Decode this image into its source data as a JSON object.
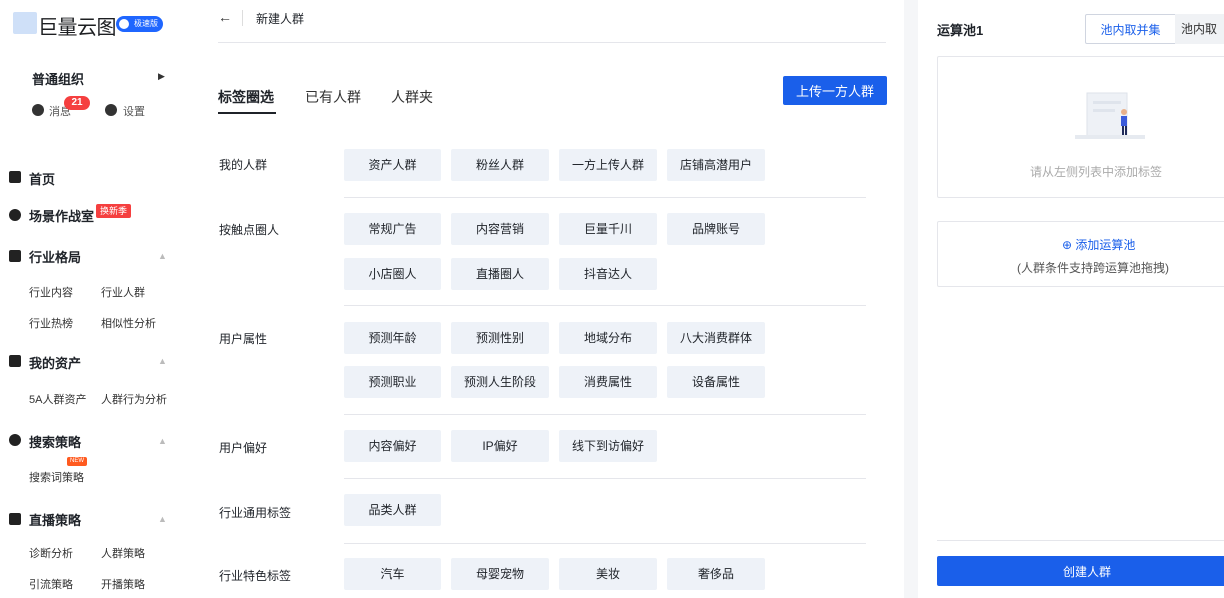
{
  "logo": {
    "text": "巨量云图",
    "badge": "极速版"
  },
  "sidebar": {
    "org": "普通组织",
    "messages_label": "消息",
    "messages_count": "21",
    "settings_label": "设置",
    "nav": [
      {
        "label": "首页"
      },
      {
        "label": "场景作战室",
        "tag": "换新季"
      },
      {
        "label": "行业格局",
        "subs": [
          "行业内容",
          "行业人群",
          "行业热榜",
          "相似性分析"
        ]
      },
      {
        "label": "我的资产",
        "subs": [
          "5A人群资产",
          "人群行为分析"
        ]
      },
      {
        "label": "搜索策略",
        "subs": [
          "搜索词策略"
        ],
        "tag": "NEW"
      },
      {
        "label": "直播策略",
        "subs": [
          "诊断分析",
          "人群策略",
          "引流策略",
          "开播策略"
        ]
      }
    ]
  },
  "header": {
    "back": "←",
    "title": "新建人群"
  },
  "tabs": [
    "标签圈选",
    "已有人群",
    "人群夹"
  ],
  "upload_button": "上传一方人群",
  "sections": [
    {
      "label": "我的人群",
      "tags": [
        "资产人群",
        "粉丝人群",
        "一方上传人群",
        "店铺高潜用户"
      ]
    },
    {
      "label": "按触点圈人",
      "tags": [
        "常规广告",
        "内容营销",
        "巨量千川",
        "品牌账号",
        "小店圈人",
        "直播圈人",
        "抖音达人"
      ]
    },
    {
      "label": "用户属性",
      "tags": [
        "预测年龄",
        "预测性别",
        "地域分布",
        "八大消费群体",
        "预测职业",
        "预测人生阶段",
        "消费属性",
        "设备属性"
      ]
    },
    {
      "label": "用户偏好",
      "tags": [
        "内容偏好",
        "IP偏好",
        "线下到访偏好"
      ]
    },
    {
      "label": "行业通用标签",
      "tags": [
        "品类人群"
      ]
    },
    {
      "label": "行业特色标签",
      "tags": [
        "汽车",
        "母婴宠物",
        "美妆",
        "奢侈品"
      ]
    }
  ],
  "right": {
    "pool_title": "运算池1",
    "seg_union": "池内取并集",
    "seg_intersect": "池内取",
    "empty_text": "请从左侧列表中添加标签",
    "add_pool": "添加运算池",
    "add_hint": "(人群条件支持跨运算池拖拽)",
    "create_button": "创建人群"
  },
  "colors": {
    "primary": "#1a5fea",
    "pill_bg": "#eef2f8",
    "badge_red": "#f53f3f"
  }
}
